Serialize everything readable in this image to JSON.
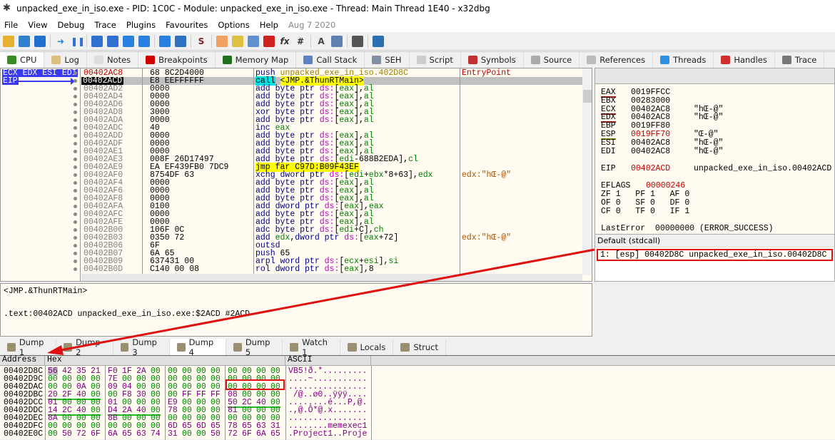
{
  "title": "unpacked_exe_in_iso.exe - PID: 1C0C - Module: unpacked_exe_in_iso.exe - Thread: Main Thread 1E40 - x32dbg",
  "menu": [
    "File",
    "View",
    "Debug",
    "Trace",
    "Plugins",
    "Favourites",
    "Options",
    "Help"
  ],
  "build_date": "Aug 7 2020",
  "toolbar_icons": [
    "open-icon",
    "restart-icon",
    "stop-icon",
    "run-icon",
    "pause-icon",
    "step-into-icon",
    "step-over-icon",
    "trace-into-icon",
    "trace-over-icon",
    "execute-till-return-icon",
    "run-to-user-code-icon",
    "script-icon",
    "patch-icon",
    "comments-icon",
    "labels-icon",
    "bookmarks-icon",
    "functions-icon",
    "hash-icon",
    "strings-icon",
    "calls-icon",
    "calculator-icon",
    "globe-icon"
  ],
  "main_tabs": [
    {
      "label": "CPU",
      "icon": "cpu-icon",
      "color": "#3a8a2a"
    },
    {
      "label": "Log",
      "icon": "log-icon",
      "color": "#d8c080"
    },
    {
      "label": "Notes",
      "icon": "notes-icon",
      "color": "#ddd"
    },
    {
      "label": "Breakpoints",
      "icon": "breakpoint-icon",
      "color": "#d00000"
    },
    {
      "label": "Memory Map",
      "icon": "memory-icon",
      "color": "#207020"
    },
    {
      "label": "Call Stack",
      "icon": "callstack-icon",
      "color": "#6080c0"
    },
    {
      "label": "SEH",
      "icon": "seh-icon",
      "color": "#8090a0"
    },
    {
      "label": "Script",
      "icon": "script-icon",
      "color": "#ccc"
    },
    {
      "label": "Symbols",
      "icon": "symbols-icon",
      "color": "#c03030"
    },
    {
      "label": "Source",
      "icon": "source-icon",
      "color": "#aaa"
    },
    {
      "label": "References",
      "icon": "references-icon",
      "color": "#bbb"
    },
    {
      "label": "Threads",
      "icon": "threads-icon",
      "color": "#3090e0"
    },
    {
      "label": "Handles",
      "icon": "handles-icon",
      "color": "#d03030"
    },
    {
      "label": "Trace",
      "icon": "trace-icon",
      "color": "#777"
    }
  ],
  "active_main_tab": "CPU",
  "gutter_tags": {
    "regs": "ECX EDX ESI EDI",
    "eip": "EIP"
  },
  "disasm": [
    [
      "00402AC8",
      "68 8C2D4000",
      "push unpacked_exe_in_iso.402D8C",
      "EntryPoint"
    ],
    [
      "00402ACD",
      "E8 EEFFFFFF",
      "call <JMP.&ThunRTMain>",
      ""
    ],
    [
      "00402AD2",
      "0000",
      "add byte ptr ds:[eax],al",
      ""
    ],
    [
      "00402AD4",
      "0000",
      "add byte ptr ds:[eax],al",
      ""
    ],
    [
      "00402AD6",
      "0000",
      "add byte ptr ds:[eax],al",
      ""
    ],
    [
      "00402AD8",
      "3000",
      "xor byte ptr ds:[eax],al",
      ""
    ],
    [
      "00402ADA",
      "0000",
      "add byte ptr ds:[eax],al",
      ""
    ],
    [
      "00402ADC",
      "40",
      "inc eax",
      ""
    ],
    [
      "00402ADD",
      "0000",
      "add byte ptr ds:[eax],al",
      ""
    ],
    [
      "00402ADF",
      "0000",
      "add byte ptr ds:[eax],al",
      ""
    ],
    [
      "00402AE1",
      "0000",
      "add byte ptr ds:[eax],al",
      ""
    ],
    [
      "00402AE3",
      "008F 26D17497",
      "add byte ptr ds:[edi-688B2EDA],cl",
      ""
    ],
    [
      "00402AE9",
      "EA EF439FB0 7DC9",
      "jmp far C97D:B09F43EF",
      ""
    ],
    [
      "00402AF0",
      "8754DF 63",
      "xchg dword ptr ds:[edi+ebx*8+63],edx",
      "edx:\"hŒ-@\""
    ],
    [
      "00402AF4",
      "0000",
      "add byte ptr ds:[eax],al",
      ""
    ],
    [
      "00402AF6",
      "0000",
      "add byte ptr ds:[eax],al",
      ""
    ],
    [
      "00402AF8",
      "0000",
      "add byte ptr ds:[eax],al",
      ""
    ],
    [
      "00402AFA",
      "0100",
      "add dword ptr ds:[eax],eax",
      ""
    ],
    [
      "00402AFC",
      "0000",
      "add byte ptr ds:[eax],al",
      ""
    ],
    [
      "00402AFE",
      "0000",
      "add byte ptr ds:[eax],al",
      ""
    ],
    [
      "00402B00",
      "106F 0C",
      "adc byte ptr ds:[edi+C],ch",
      ""
    ],
    [
      "00402B03",
      "0350 72",
      "add edx,dword ptr ds:[eax+72]",
      "edx:\"hŒ-@\""
    ],
    [
      "00402B06",
      "6F",
      "outsd",
      ""
    ],
    [
      "00402B07",
      "6A 65",
      "push 65",
      ""
    ],
    [
      "00402B09",
      "637431 00",
      "arpl word ptr ds:[ecx+esi],si",
      ""
    ],
    [
      "00402B0D",
      "C140 00 08",
      "rol dword ptr ds:[eax],8",
      ""
    ]
  ],
  "selected_address": "00402ACD",
  "registers": [
    [
      "EAX",
      "0019FFCC",
      ""
    ],
    [
      "EBX",
      "00283000",
      ""
    ],
    [
      "ECX",
      "00402AC8",
      "\"hŒ-@\""
    ],
    [
      "EDX",
      "00402AC8",
      "\"hŒ-@\""
    ],
    [
      "EBP",
      "0019FF80",
      ""
    ],
    [
      "ESP",
      "0019FF70",
      "\"Œ-@\""
    ],
    [
      "ESI",
      "00402AC8",
      "\"hŒ-@\""
    ],
    [
      "EDI",
      "00402AC8",
      "\"hŒ-@\""
    ]
  ],
  "eip": [
    "EIP",
    "00402ACD",
    "unpacked_exe_in_iso.00402ACD"
  ],
  "eflags": [
    "EFLAGS",
    "00000246"
  ],
  "flags": [
    "ZF 1   PF 1   AF 0",
    "OF 0   SF 0   DF 0",
    "CF 0   TF 0   IF 1"
  ],
  "last_error": "LastError  00000000 (ERROR_SUCCESS)",
  "callstack": {
    "convention": "Default (stdcall)",
    "row": "1: [esp] 00402D8C unpacked_exe_in_iso.00402D8C"
  },
  "info": {
    "line1": "<JMP.&ThunRTMain>",
    "line2": ".text:00402ACD unpacked_exe_in_iso.exe:$2ACD #2ACD"
  },
  "dump_tabs": [
    "Dump 1",
    "Dump 2",
    "Dump 3",
    "Dump 4",
    "Dump 5",
    "Watch 1",
    "Locals",
    "Struct"
  ],
  "active_dump_tab": "Dump 4",
  "dump_header": {
    "address": "Address",
    "hex": "Hex",
    "ascii": "ASCII"
  },
  "dump": [
    [
      "00402D8C",
      "56 42 35 21 F0 1F 2A 00 00 00 00 00 00 00 00 00",
      "VB5!ð.*........."
    ],
    [
      "00402D9C",
      "00 00 00 00 7E 00 00 00 00 00 00 00 00 00 00 00",
      "....~..........."
    ],
    [
      "00402DAC",
      "00 00 0A 00 09 04 00 00 00 00 00 00 00 00 00 00",
      "................"
    ],
    [
      "00402DBC",
      "20 2F 40 00 00 F8 30 00 00 FF FF FF 08 00 00 00",
      " /@..ø0..ÿÿÿ...."
    ],
    [
      "00402DCC",
      "01 00 00 00 01 00 00 00 E9 00 00 00 50 2C 40 00",
      "........é...P,@."
    ],
    [
      "00402DDC",
      "14 2C 40 00 D4 2A 40 00 78 00 00 00 81 00 00 00",
      ".,@.Ô*@.x......."
    ],
    [
      "00402DEC",
      "8A 00 00 00 8B 00 00 00 00 00 00 00 00 00 00 00",
      "................"
    ],
    [
      "00402DFC",
      "00 00 00 00 00 00 00 00 6D 65 6D 65 78 65 63 31",
      "........memexec1"
    ],
    [
      "00402E0C",
      "00 50 72 6F 6A 65 63 74 31 00 00 50 72 6F 6A 65",
      ".Project1..Proje"
    ]
  ],
  "annotation_color": "#e01010",
  "pointer_underline_color": "#20c020"
}
